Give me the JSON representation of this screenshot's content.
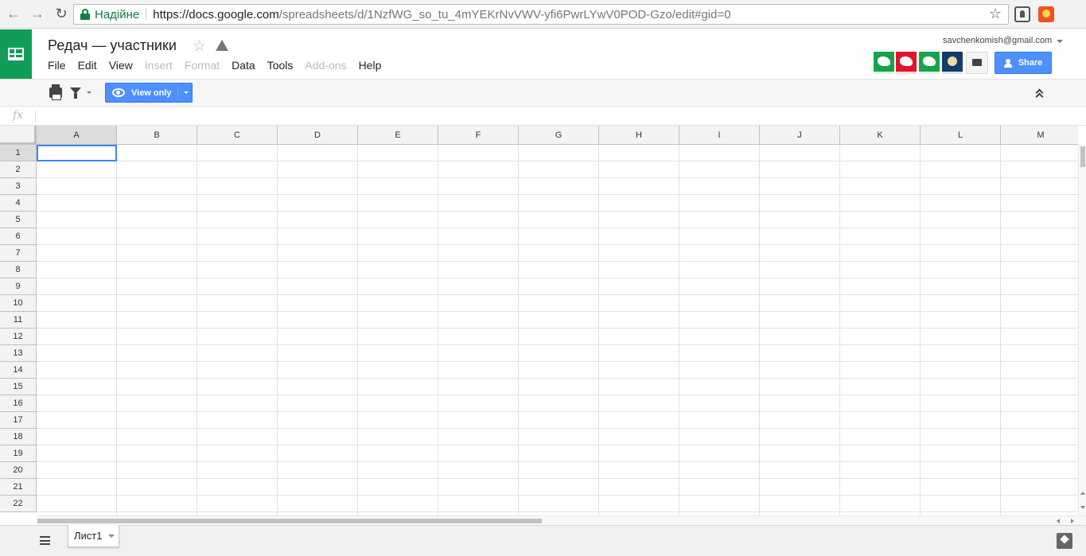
{
  "browser": {
    "secure_label": "Надійне",
    "url_host": "https://docs.google.com",
    "url_path": "/spreadsheets/d/1NzfWG_so_tu_4mYEKrNvVWV-yfi6PwrLYwV0POD-Gzo/edit#gid=0",
    "icons": {
      "back": "←",
      "forward": "→",
      "reload": "↻",
      "bookmark": "☆"
    }
  },
  "header": {
    "doc_title": "Редач — участники",
    "title_star": "☆",
    "account_email": "savchenkomish@gmail.com",
    "share_label": "Share",
    "menu": [
      {
        "label": "File",
        "enabled": true
      },
      {
        "label": "Edit",
        "enabled": true
      },
      {
        "label": "View",
        "enabled": true
      },
      {
        "label": "Insert",
        "enabled": false
      },
      {
        "label": "Format",
        "enabled": false
      },
      {
        "label": "Data",
        "enabled": true
      },
      {
        "label": "Tools",
        "enabled": true
      },
      {
        "label": "Add-ons",
        "enabled": false
      },
      {
        "label": "Help",
        "enabled": true
      }
    ]
  },
  "toolbar": {
    "view_only_label": "View only"
  },
  "formula_bar": {
    "fx_label": "fx",
    "value": ""
  },
  "grid": {
    "columns": [
      "A",
      "B",
      "C",
      "D",
      "E",
      "F",
      "G",
      "H",
      "I",
      "J",
      "K",
      "L",
      "M"
    ],
    "rows": [
      "1",
      "2",
      "3",
      "4",
      "5",
      "6",
      "7",
      "8",
      "9",
      "10",
      "11",
      "12",
      "13",
      "14",
      "15",
      "16",
      "17",
      "18",
      "19",
      "20",
      "21",
      "22"
    ],
    "selected_cell": "A1"
  },
  "sheets": {
    "tabs": [
      "Лист1"
    ]
  },
  "colors": {
    "sheets_green": "#0f9d58",
    "primary_blue": "#4d90fe",
    "selection_blue": "#4285f4"
  }
}
